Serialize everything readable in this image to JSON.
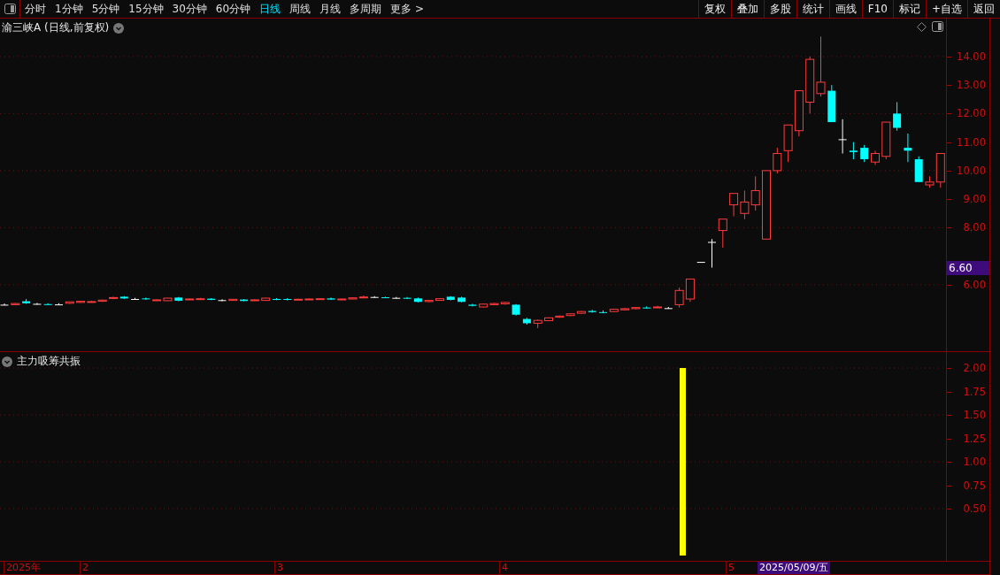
{
  "toolbar": {
    "periods": [
      {
        "label": "分时",
        "selected": false
      },
      {
        "label": "1分钟",
        "selected": false
      },
      {
        "label": "5分钟",
        "selected": false
      },
      {
        "label": "15分钟",
        "selected": false
      },
      {
        "label": "30分钟",
        "selected": false
      },
      {
        "label": "60分钟",
        "selected": false
      },
      {
        "label": "日线",
        "selected": true
      },
      {
        "label": "周线",
        "selected": false
      },
      {
        "label": "月线",
        "selected": false
      },
      {
        "label": "多周期",
        "selected": false
      },
      {
        "label": "更多 >",
        "selected": false
      }
    ],
    "buttons": [
      "复权",
      "叠加",
      "多股",
      "统计",
      "画线",
      "F10",
      "标记",
      "+自选",
      "返回"
    ]
  },
  "main_pane": {
    "title": "渝三峡A (日线,前复权)",
    "cursor_price": "6.60",
    "chart_data": {
      "type": "candlestick",
      "ylim": [
        3.67,
        15.33
      ],
      "yticks": [
        {
          "value": 14,
          "label": "14.00"
        },
        {
          "value": 13,
          "label": "13.00"
        },
        {
          "value": 12,
          "label": "12.00"
        },
        {
          "value": 11,
          "label": "11.00"
        },
        {
          "value": 10,
          "label": "10.00"
        },
        {
          "value": 9,
          "label": "9.00"
        },
        {
          "value": 8,
          "label": "8.00"
        },
        {
          "value": 6,
          "label": "6.00"
        }
      ],
      "grid": true,
      "ohlc": [
        [
          5.3,
          5.34,
          5.28,
          5.3
        ],
        [
          5.3,
          5.36,
          5.28,
          5.34
        ],
        [
          5.42,
          5.5,
          5.33,
          5.35
        ],
        [
          5.33,
          5.36,
          5.3,
          5.33
        ],
        [
          5.32,
          5.35,
          5.29,
          5.31
        ],
        [
          5.31,
          5.35,
          5.28,
          5.31
        ],
        [
          5.35,
          5.4,
          5.33,
          5.4
        ],
        [
          5.38,
          5.43,
          5.36,
          5.42
        ],
        [
          5.4,
          5.44,
          5.37,
          5.41
        ],
        [
          5.42,
          5.48,
          5.4,
          5.46
        ],
        [
          5.52,
          5.58,
          5.49,
          5.55
        ],
        [
          5.58,
          5.6,
          5.5,
          5.52
        ],
        [
          5.5,
          5.54,
          5.48,
          5.5
        ],
        [
          5.52,
          5.55,
          5.47,
          5.49
        ],
        [
          5.45,
          5.49,
          5.43,
          5.47
        ],
        [
          5.44,
          5.54,
          5.43,
          5.53
        ],
        [
          5.55,
          5.57,
          5.42,
          5.44
        ],
        [
          5.47,
          5.52,
          5.46,
          5.5
        ],
        [
          5.5,
          5.54,
          5.47,
          5.51
        ],
        [
          5.51,
          5.53,
          5.46,
          5.47
        ],
        [
          5.46,
          5.49,
          5.42,
          5.46
        ],
        [
          5.45,
          5.5,
          5.44,
          5.49
        ],
        [
          5.48,
          5.5,
          5.42,
          5.43
        ],
        [
          5.44,
          5.49,
          5.43,
          5.47
        ],
        [
          5.45,
          5.54,
          5.44,
          5.53
        ],
        [
          5.5,
          5.53,
          5.46,
          5.48
        ],
        [
          5.5,
          5.53,
          5.45,
          5.47
        ],
        [
          5.47,
          5.51,
          5.45,
          5.49
        ],
        [
          5.48,
          5.52,
          5.47,
          5.5
        ],
        [
          5.5,
          5.53,
          5.48,
          5.51
        ],
        [
          5.52,
          5.55,
          5.47,
          5.48
        ],
        [
          5.47,
          5.51,
          5.46,
          5.5
        ],
        [
          5.5,
          5.55,
          5.49,
          5.54
        ],
        [
          5.56,
          5.62,
          5.54,
          5.57
        ],
        [
          5.57,
          5.6,
          5.55,
          5.57
        ],
        [
          5.56,
          5.58,
          5.53,
          5.55
        ],
        [
          5.54,
          5.57,
          5.52,
          5.54
        ],
        [
          5.54,
          5.57,
          5.5,
          5.51
        ],
        [
          5.52,
          5.55,
          5.38,
          5.4
        ],
        [
          5.41,
          5.46,
          5.39,
          5.45
        ],
        [
          5.45,
          5.52,
          5.44,
          5.51
        ],
        [
          5.58,
          5.6,
          5.45,
          5.47
        ],
        [
          5.55,
          5.58,
          5.38,
          5.4
        ],
        [
          5.3,
          5.33,
          5.24,
          5.26
        ],
        [
          5.22,
          5.34,
          5.2,
          5.32
        ],
        [
          5.3,
          5.36,
          5.28,
          5.34
        ],
        [
          5.33,
          5.4,
          5.3,
          5.38
        ],
        [
          5.3,
          5.32,
          4.92,
          4.95
        ],
        [
          4.8,
          4.84,
          4.6,
          4.65
        ],
        [
          4.65,
          4.78,
          4.48,
          4.75
        ],
        [
          4.74,
          4.86,
          4.72,
          4.84
        ],
        [
          4.86,
          4.92,
          4.84,
          4.9
        ],
        [
          4.92,
          5.0,
          4.9,
          4.98
        ],
        [
          5.0,
          5.08,
          4.98,
          5.06
        ],
        [
          5.08,
          5.12,
          5.02,
          5.04
        ],
        [
          5.04,
          5.1,
          5.0,
          5.02
        ],
        [
          5.06,
          5.16,
          5.04,
          5.14
        ],
        [
          5.12,
          5.18,
          5.1,
          5.16
        ],
        [
          5.16,
          5.22,
          5.14,
          5.2
        ],
        [
          5.2,
          5.24,
          5.16,
          5.18
        ],
        [
          5.2,
          5.26,
          5.18,
          5.22
        ],
        [
          5.18,
          5.22,
          5.16,
          5.18
        ],
        [
          5.3,
          5.9,
          5.2,
          5.8
        ],
        [
          5.5,
          6.2,
          5.4,
          6.2
        ],
        [
          6.8,
          6.8,
          6.8,
          6.8
        ],
        [
          7.5,
          7.6,
          6.6,
          7.5
        ],
        [
          7.9,
          8.3,
          7.3,
          8.3
        ],
        [
          8.8,
          9.2,
          8.4,
          9.2
        ],
        [
          8.5,
          9.3,
          8.3,
          8.9
        ],
        [
          8.8,
          9.8,
          8.6,
          9.3
        ],
        [
          7.6,
          10.0,
          7.6,
          10.0
        ],
        [
          10.0,
          10.8,
          9.9,
          10.6
        ],
        [
          10.7,
          11.6,
          10.3,
          11.6
        ],
        [
          11.4,
          12.8,
          11.2,
          12.8
        ],
        [
          12.4,
          14.0,
          12.0,
          13.9
        ],
        [
          12.7,
          14.7,
          12.6,
          13.1
        ],
        [
          12.8,
          13.0,
          11.7,
          11.7
        ],
        [
          11.1,
          11.8,
          10.6,
          11.1
        ],
        [
          10.7,
          11.0,
          10.4,
          10.65
        ],
        [
          10.8,
          10.9,
          10.3,
          10.4
        ],
        [
          10.3,
          10.7,
          10.2,
          10.6
        ],
        [
          10.5,
          11.7,
          10.4,
          11.7
        ],
        [
          12.0,
          12.4,
          11.4,
          11.5
        ],
        [
          10.8,
          11.3,
          10.3,
          10.7
        ],
        [
          10.4,
          10.5,
          9.6,
          9.6
        ],
        [
          9.5,
          9.8,
          9.4,
          9.6
        ],
        [
          9.6,
          10.6,
          9.4,
          10.6
        ]
      ]
    }
  },
  "indicator_pane": {
    "title": "主力吸筹共振",
    "chart_data": {
      "type": "bar",
      "grid": true,
      "ylim": [
        0,
        2.17
      ],
      "yticks": [
        {
          "value": 2.0,
          "label": "2.00"
        },
        {
          "value": 1.75,
          "label": "1.75"
        },
        {
          "value": 1.5,
          "label": "1.50"
        },
        {
          "value": 1.25,
          "label": "1.25"
        },
        {
          "value": 1.0,
          "label": "1.00"
        },
        {
          "value": 0.75,
          "label": "0.75"
        },
        {
          "value": 0.5,
          "label": "0.50"
        }
      ],
      "series": [
        {
          "color": "#ffff00",
          "values": [
            2.0
          ]
        }
      ]
    }
  },
  "time_axis": {
    "labels": [
      "2025年",
      "2",
      "3",
      "4",
      "5"
    ],
    "cursor_date": "2025/05/09/五"
  }
}
